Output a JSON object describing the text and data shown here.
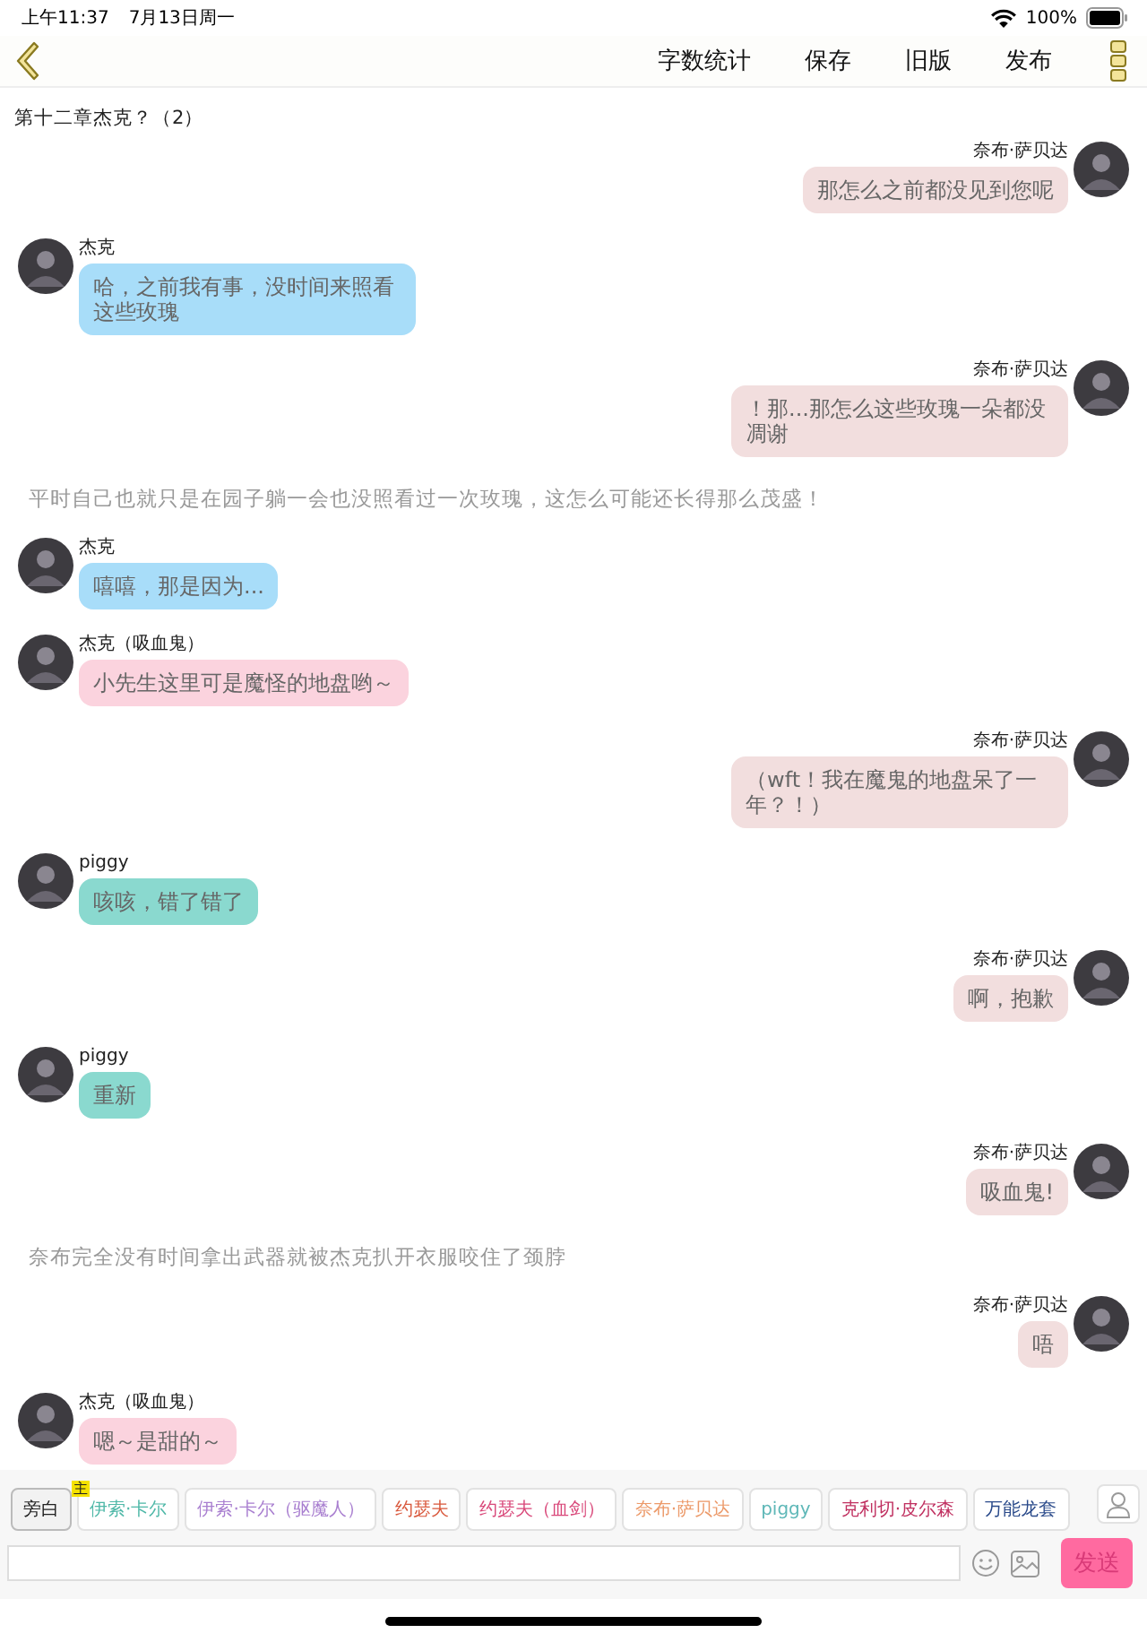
{
  "status_bar": {
    "time": "上午11:37",
    "date": "7月13日周一",
    "battery": "100%"
  },
  "toolbar": {
    "actions": [
      "字数统计",
      "保存",
      "旧版",
      "发布"
    ]
  },
  "chapter_title": "第十二章杰克？（2）",
  "messages": [
    {
      "kind": "right",
      "sender": "奈布·萨贝达",
      "text": "那怎么之前都没见到您呢",
      "color": "#f2dede"
    },
    {
      "kind": "left",
      "sender": "杰克",
      "text": "哈，之前我有事，没时间来照看这些玫瑰",
      "color": "#a8ddf9"
    },
    {
      "kind": "right",
      "sender": "奈布·萨贝达",
      "text": "！那...那怎么这些玫瑰一朵都没凋谢",
      "color": "#f2dede"
    },
    {
      "kind": "narration",
      "text": "平时自己也就只是在园子躺一会也没照看过一次玫瑰，这怎么可能还长得那么茂盛！"
    },
    {
      "kind": "left",
      "sender": "杰克",
      "text": "嘻嘻，那是因为...",
      "color": "#a8ddf9"
    },
    {
      "kind": "left",
      "sender": "杰克（吸血鬼）",
      "text": "小先生这里可是魔怪的地盘哟～",
      "color": "#fbd3de"
    },
    {
      "kind": "right",
      "sender": "奈布·萨贝达",
      "text": "（wft！我在魔鬼的地盘呆了一年？！）",
      "color": "#f2dede"
    },
    {
      "kind": "left",
      "sender": "piggy",
      "text": "咳咳，错了错了",
      "color": "#8ad9cf"
    },
    {
      "kind": "right",
      "sender": "奈布·萨贝达",
      "text": "啊，抱歉",
      "color": "#f2dede"
    },
    {
      "kind": "left",
      "sender": "piggy",
      "text": "重新",
      "color": "#8ad9cf"
    },
    {
      "kind": "right",
      "sender": "奈布·萨贝达",
      "text": "吸血鬼!",
      "color": "#f2dede"
    },
    {
      "kind": "narration",
      "text": "奈布完全没有时间拿出武器就被杰克扒开衣服咬住了颈脖"
    },
    {
      "kind": "right",
      "sender": "奈布·萨贝达",
      "text": "唔",
      "color": "#f2dede"
    },
    {
      "kind": "left",
      "sender": "杰克（吸血鬼）",
      "text": "嗯～是甜的～",
      "color": "#fbd3de"
    }
  ],
  "characters": [
    {
      "name": "旁白",
      "color": "#222222",
      "selected": true
    },
    {
      "name": "伊索·卡尔",
      "color": "#4fb8a8",
      "selected": false,
      "badge": "主"
    },
    {
      "name": "伊索·卡尔（驱魔人）",
      "color": "#a97fd0",
      "selected": false
    },
    {
      "name": "约瑟夫",
      "color": "#d9583c",
      "selected": false
    },
    {
      "name": "约瑟夫（血剑）",
      "color": "#d9487a",
      "selected": false
    },
    {
      "name": "奈布·萨贝达",
      "color": "#ec9a6a",
      "selected": false
    },
    {
      "name": "piggy",
      "color": "#5fb8b8",
      "selected": false
    },
    {
      "name": "克利切·皮尔森",
      "color": "#c03060",
      "selected": false
    },
    {
      "name": "万能龙套",
      "color": "#2a4a8a",
      "selected": false
    }
  ],
  "composer": {
    "send": "发送"
  }
}
